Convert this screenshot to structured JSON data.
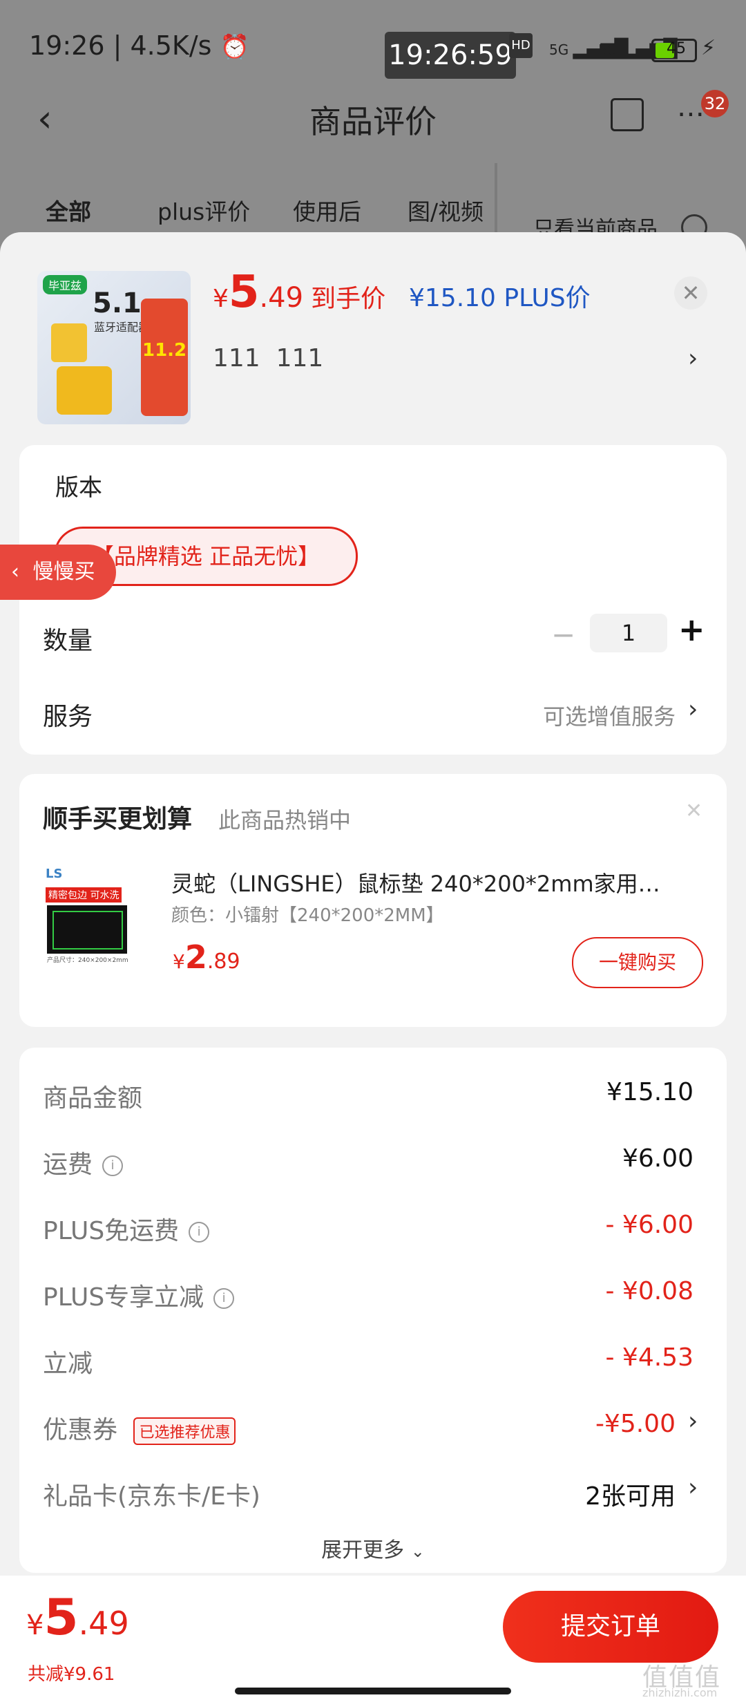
{
  "status_bar": {
    "time": "19:26",
    "speed": "4.5K/s",
    "clock": "19:26:59",
    "hd": "HD",
    "net1": "5G",
    "net2": "5G",
    "battery": "45"
  },
  "nav": {
    "title": "商品评价",
    "badge": "32"
  },
  "tabs": [
    "全部",
    "plus评价",
    "使用后",
    "图/视频"
  ],
  "filter_label": "只看当前商品",
  "product": {
    "thumb_text": "5.1",
    "thumb_sub": "蓝牙适配器",
    "thumb_brand": "毕亚兹",
    "thumb_promo": "11.2",
    "price_symbol": "¥",
    "price_int": "5",
    "price_dec": ".49",
    "price_tag": "到手价",
    "plus_price": "¥15.10 PLUS价",
    "spec": "111  111"
  },
  "version": {
    "label": "版本",
    "option": "【品牌精选 正品无忧】"
  },
  "float_tab": "慢慢买",
  "quantity": {
    "label": "数量",
    "value": "1",
    "minus": "−",
    "plus": "+"
  },
  "service": {
    "label": "服务",
    "value": "可选增值服务"
  },
  "addon": {
    "title": "顺手买更划算",
    "subtitle": "此商品热销中",
    "item_name": "灵蛇（LINGSHE）鼠标垫 240*200*2mm家用…",
    "item_spec": "颜色：小镭射【240*200*2MM】",
    "thumb_tag": "精密包边 可水洗",
    "thumb_logo": "LS",
    "thumb_caption": "产品尺寸：240×200×2mm",
    "price_symbol": "¥",
    "price_int": "2",
    "price_dec": ".89",
    "buy_label": "一键购买"
  },
  "summary": {
    "rows": [
      {
        "label": "商品金额",
        "value": "¥15.10",
        "style": "normal",
        "info": false
      },
      {
        "label": "运费",
        "value": "¥6.00",
        "style": "normal",
        "info": true
      },
      {
        "label": "PLUS免运费",
        "value": "- ¥6.00",
        "style": "red",
        "info": true
      },
      {
        "label": "PLUS专享立减",
        "value": "- ¥0.08",
        "style": "red",
        "info": true
      },
      {
        "label": "立减",
        "value": "- ¥4.53",
        "style": "red",
        "info": false
      }
    ],
    "coupon_label": "优惠券",
    "coupon_tag": "已选推荐优惠",
    "coupon_value": "-¥5.00",
    "giftcard_label": "礼品卡(京东卡/E卡)",
    "giftcard_value": "2张可用",
    "expand": "展开更多"
  },
  "footer": {
    "price_symbol": "¥",
    "price_int": "5",
    "price_dec": ".49",
    "saved": "共减¥9.61",
    "submit": "提交订单",
    "watermark": "值值值",
    "watermark_url": "zhizhizhi.com"
  },
  "colors": {
    "accent": "#e2231a",
    "plus_blue": "#1f57c3"
  }
}
